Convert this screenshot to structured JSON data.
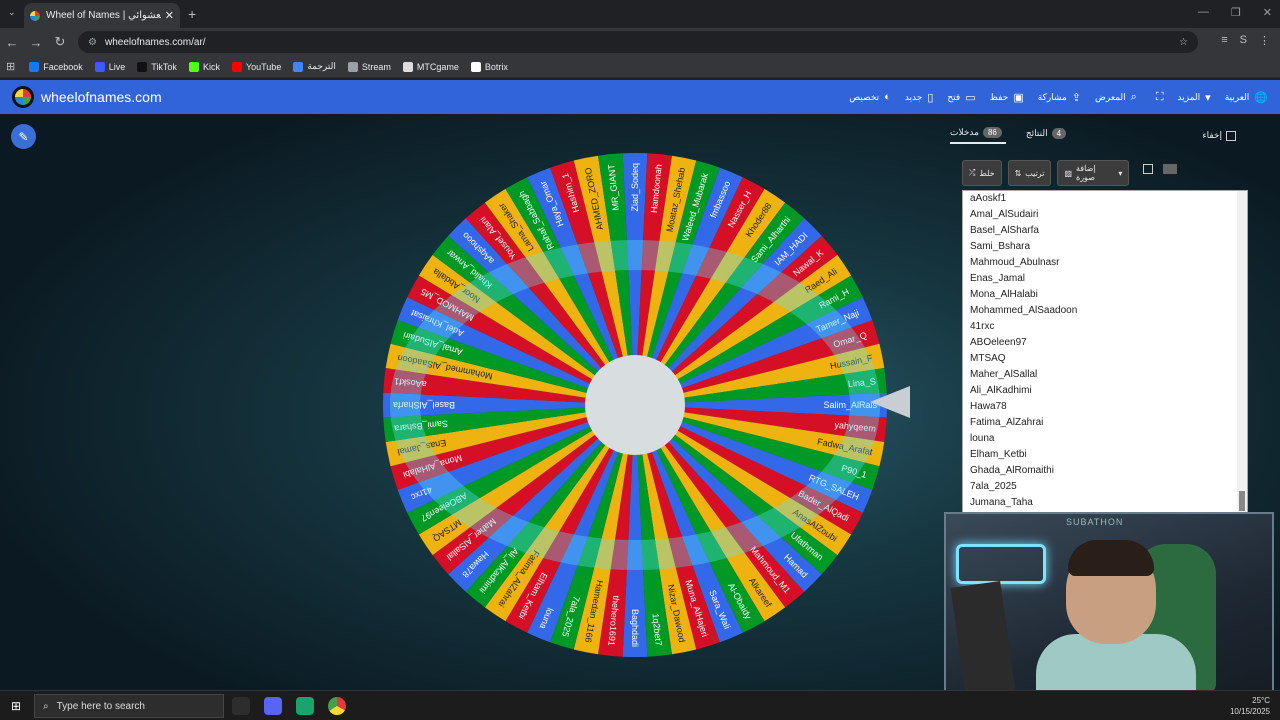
{
  "browser": {
    "tab_title": "Wheel of Names | عجلة الاسم العشوائي",
    "tab_close": "✕",
    "new_tab": "+",
    "tab_menu": "⌄",
    "url": "wheelofnames.com/ar/",
    "bookmarks": [
      {
        "label": "Facebook",
        "color": "#1877f2"
      },
      {
        "label": "Live",
        "color": "#3d5afe"
      },
      {
        "label": "TikTok",
        "color": "#111111"
      },
      {
        "label": "Kick",
        "color": "#53fc18"
      },
      {
        "label": "YouTube",
        "color": "#ff0000"
      },
      {
        "label": "الترجمة",
        "color": "#4285f4"
      },
      {
        "label": "Stream",
        "color": "#9aa0a6"
      },
      {
        "label": "MTCgame",
        "color": "#dddddd"
      },
      {
        "label": "Botrix",
        "color": "#ffffff"
      }
    ],
    "profile_initial": "S"
  },
  "app": {
    "brand": "wheelofnames.com",
    "menu": [
      {
        "label": "العربية",
        "icon": "globe-icon",
        "glyph": "🌐"
      },
      {
        "label": "المزيد",
        "icon": "chevron-down-icon",
        "glyph": "▾"
      },
      {
        "label": "",
        "icon": "fullscreen-icon",
        "glyph": "⛶"
      },
      {
        "label": "المعرض",
        "icon": "search-icon",
        "glyph": "⌕"
      },
      {
        "label": "مشاركة",
        "icon": "share-icon",
        "glyph": "⇪"
      },
      {
        "label": "حفظ",
        "icon": "save-icon",
        "glyph": "▣"
      },
      {
        "label": "فتح",
        "icon": "folder-icon",
        "glyph": "▭"
      },
      {
        "label": "جديد",
        "icon": "new-file-icon",
        "glyph": "▯"
      },
      {
        "label": "تخصيص",
        "icon": "palette-icon",
        "glyph": "◐"
      }
    ]
  },
  "panel": {
    "entries_tab": "مدخلات",
    "entries_count": "86",
    "results_tab": "النتائج",
    "results_count": "4",
    "hide_label": "إخفاء",
    "shuffle_label": "خلط",
    "sort_label": "ترتيب",
    "add_image_label": "إضافة صورة",
    "entries": [
      "aAoskf1",
      "Amal_AlSudairi",
      "Basel_AlSharfa",
      "Sami_Bshara",
      "Mahmoud_Abulnasr",
      "Enas_Jamal",
      "Mona_AlHalabi",
      "Mohammed_AlSaadoon",
      "41rxc",
      "ABOeleen97",
      "MTSAQ",
      "Maher_AlSallal",
      "Ali_AlKadhimi",
      "Hawa78",
      "Fatima_AlZahrai",
      "louna",
      "Elham_Ketbi",
      "Ghada_AlRomaithi",
      "7ala_2025",
      "Jumana_Taha"
    ]
  },
  "wheel": {
    "colors": [
      "#3369e8",
      "#d50f25",
      "#eeb211",
      "#009925"
    ],
    "labels": [
      "Salim_AlRais",
      "yahyqeem",
      "Fadwa_Arafat",
      "P90_1",
      "RTG_SALEH",
      "Bader_AlQadi",
      "AnasAlZoubi",
      "Ufathman",
      "Hamad",
      "Mahmoud_M1",
      "Alkareef",
      "Al-Obaidy",
      "Sara_Wali",
      "Muna_AlHajeri",
      "Nizar_Dawood",
      "1q2bet7",
      "Baghdadi",
      "thehero1691",
      "Hamedan_1166",
      "7ala_2025",
      "louna",
      "Elham_Ketbi",
      "Fatima_AlZahrai",
      "Ali_AlKadhimi",
      "Hawa78",
      "Maher_AlSallal",
      "MTSAQ",
      "ABOeleen97",
      "41rxc",
      "Mona_AlHalabi",
      "Enas_Jamal",
      "Sami_Bshara",
      "Basel_AlSharfa",
      "aAoskf1",
      "Mohammed_AlSaadoon",
      "Amal_AlSudairi",
      "Adel_Khraisat",
      "MAHMOD_M5",
      "Noor_Abdalla",
      "Khalid_Anwar",
      "aAqshooo",
      "Yousef_Alani",
      "Lama_Shaker",
      "Rahaf_Sabbagh",
      "Haya_Omar",
      "Hashim_1",
      "AHMED_ZORO",
      "MR_GIANT",
      "Ziad_Sodeq",
      "Hamdoonah",
      "Moataz_Shehab",
      "Waleed_Mubarak",
      "fmbassoo",
      "Nasser_H",
      "Khoder88",
      "Sami_Alharthi",
      "IAM_HADI",
      "Nawal_K",
      "Raed_Ali",
      "Rami_H",
      "Tamer_Naji",
      "Omar_Q",
      "Hussain_F",
      "Lina_S"
    ]
  },
  "webcam": {
    "watermark": "SUBATHON"
  },
  "taskbar": {
    "search_placeholder": "Type here to search",
    "time": "",
    "date": "10/15/2025",
    "tray_text": "25°C"
  }
}
